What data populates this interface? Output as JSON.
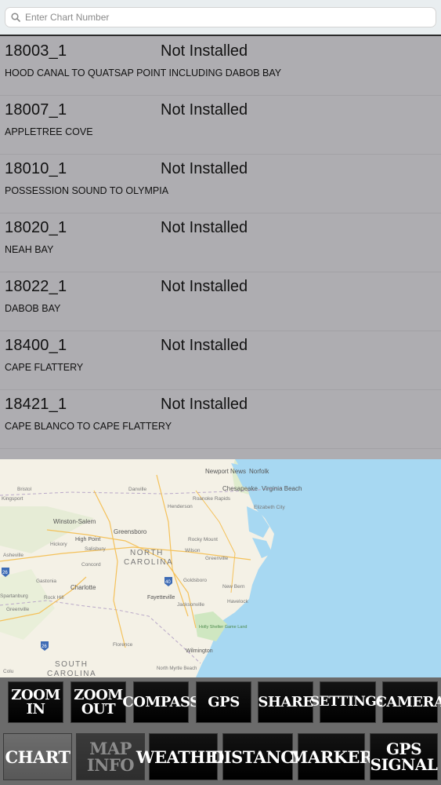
{
  "search": {
    "placeholder": "Enter Chart Number",
    "icon": "search-icon"
  },
  "charts": [
    {
      "number": "18003_1",
      "status": "Not Installed",
      "name": "HOOD CANAL TO QUATSAP POINT INCLUDING DABOB BAY"
    },
    {
      "number": "18007_1",
      "status": "Not Installed",
      "name": "APPLETREE COVE"
    },
    {
      "number": "18010_1",
      "status": "Not Installed",
      "name": "POSSESSION SOUND TO OLYMPIA"
    },
    {
      "number": "18020_1",
      "status": "Not Installed",
      "name": "NEAH BAY"
    },
    {
      "number": "18022_1",
      "status": "Not Installed",
      "name": "DABOB BAY"
    },
    {
      "number": "18400_1",
      "status": "Not Installed",
      "name": "CAPE FLATTERY"
    },
    {
      "number": "18421_1",
      "status": "Not Installed",
      "name": "CAPE BLANCO TO CAPE FLATTERY"
    }
  ],
  "map": {
    "places": [
      "Newport News",
      "Norfolk",
      "Chesapeake",
      "Virginia Beach",
      "Roanoke Rapids",
      "Danville",
      "Bristol",
      "Kingsport",
      "Henderson",
      "Elizabeth City",
      "Winston-Salem",
      "Greensboro",
      "Rocky Mount",
      "High Point",
      "Salisbury",
      "Wilson",
      "Greenville",
      "Hickory",
      "Concord",
      "Asheville",
      "NORTH",
      "CAROLINA",
      "Goldsboro",
      "Gastonia",
      "Charlotte",
      "New Bern",
      "Spartanburg",
      "Rock Hill",
      "Fayetteville",
      "Jacksonville",
      "Havelock",
      "Greenville",
      "Holly Shelter Game Land",
      "Florence",
      "Wilmington",
      "SOUTH",
      "CAROLINA",
      "North Myrtle Beach",
      "Colu"
    ],
    "highway_shields": [
      "26",
      "40",
      "26"
    ]
  },
  "toolbar": {
    "row1": [
      "ZOOM IN",
      "ZOOM OUT",
      "COMPASS",
      "GPS",
      "SHARE",
      "SETTINGS",
      "CAMERA"
    ],
    "row2": [
      "CHART",
      "MAP INFO",
      "WEATHER",
      "DISTANCE",
      "MARKER",
      "GPS SIGNAL"
    ]
  }
}
